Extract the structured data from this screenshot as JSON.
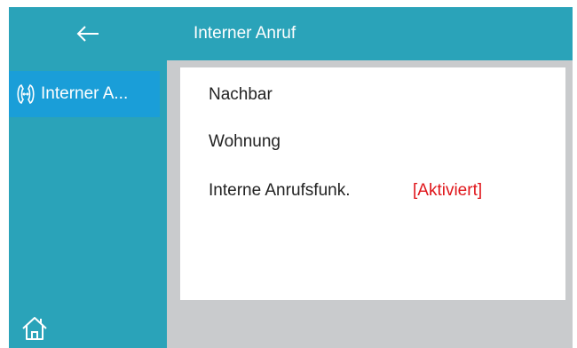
{
  "header": {
    "title": "Interner Anruf"
  },
  "sidebar": {
    "back_icon": "arrow-left-icon",
    "items": [
      {
        "icon": "intercom-call-icon",
        "label": "Interner A..."
      }
    ],
    "home_icon": "home-icon"
  },
  "menu": {
    "items": [
      {
        "label": "Nachbar"
      },
      {
        "label": "Wohnung"
      },
      {
        "label": "Interne Anrufsfunk.",
        "value": "[Aktiviert]"
      }
    ]
  },
  "colors": {
    "accent": "#2aa3b9",
    "selected": "#1a9ed8",
    "status_active": "#e0161b",
    "background": "#c9cbcd"
  }
}
